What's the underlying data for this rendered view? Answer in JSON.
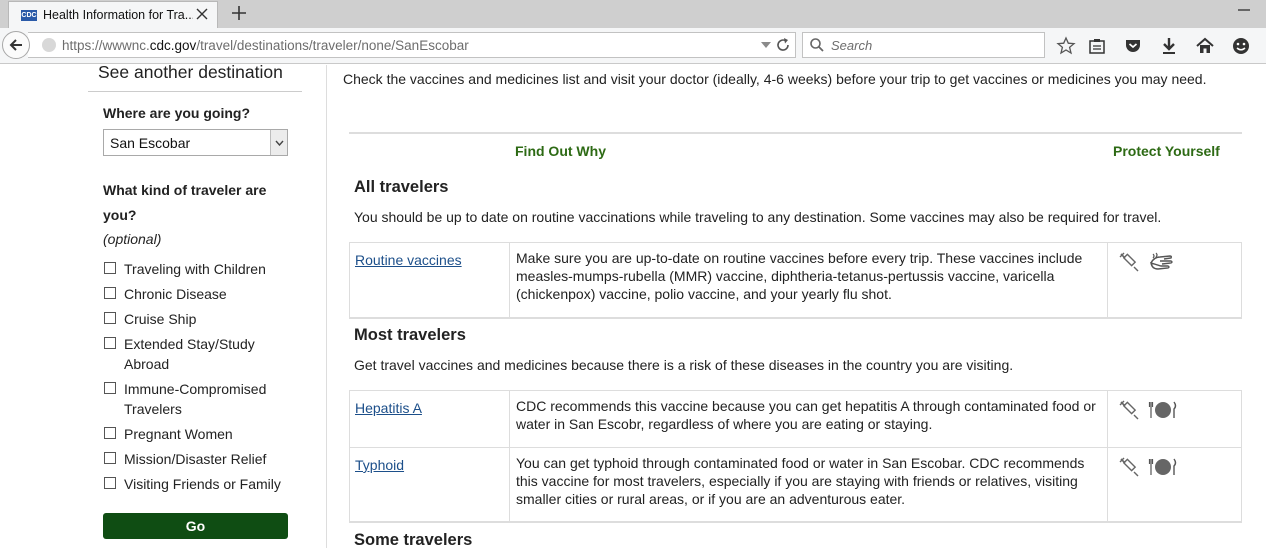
{
  "browser": {
    "tab_title": "Health Information for Tra...",
    "favicon_text": "CDC",
    "url_prefix": "https://wwwnc.",
    "url_domain": "cdc.gov",
    "url_path": "/travel/destinations/traveler/none/SanEscobar",
    "search_placeholder": "Search"
  },
  "sidebar": {
    "heading": "See another destination",
    "where_label": "Where are you going?",
    "destination_value": "San Escobar",
    "traveler_question": "What kind of traveler are you?",
    "optional_label": "(optional)",
    "traveler_options": [
      "Traveling with Children",
      "Chronic Disease",
      "Cruise Ship",
      "Extended Stay/Study Abroad",
      "Immune-Compromised Travelers",
      "Pregnant Women",
      "Mission/Disaster Relief",
      "Visiting Friends or Family"
    ],
    "go_label": "Go"
  },
  "main": {
    "intro": "Check the vaccines and medicines list and visit your doctor (ideally, 4-6 weeks) before your trip to get vaccines or medicines you may need.",
    "header_find_out_why": "Find Out Why",
    "header_protect_yourself": "Protect Yourself",
    "sections": [
      {
        "title": "All travelers",
        "description": "You should be up to date on routine vaccinations while traveling to any destination. Some vaccines may also be required for travel.",
        "rows": [
          {
            "name": "Routine vaccines",
            "text": "Make sure you are up-to-date on routine vaccines before every trip. These vaccines include measles-mumps-rubella (MMR) vaccine, diphtheria-tetanus-pertussis vaccine, varicella (chickenpox) vaccine, polio vaccine, and your yearly flu shot.",
            "icons": [
              "syringe-icon",
              "hand-wash-icon"
            ]
          }
        ]
      },
      {
        "title": "Most travelers",
        "description": "Get travel vaccines and medicines because there is a risk of these diseases in the country you are visiting.",
        "rows": [
          {
            "name": "Hepatitis A",
            "text": "CDC recommends this vaccine because you can get hepatitis A through contaminated food or water in San Escobr, regardless of where you are eating or staying.",
            "icons": [
              "syringe-icon",
              "food-plate-icon"
            ]
          },
          {
            "name": "Typhoid",
            "text": "You can get typhoid through contaminated food or water in San Escobar. CDC recommends this vaccine for most travelers, especially if you are staying with friends or relatives, visiting smaller cities or rural areas, or if you are an adventurous eater.",
            "icons": [
              "syringe-icon",
              "food-plate-icon"
            ]
          }
        ]
      },
      {
        "title": "Some travelers"
      }
    ]
  }
}
